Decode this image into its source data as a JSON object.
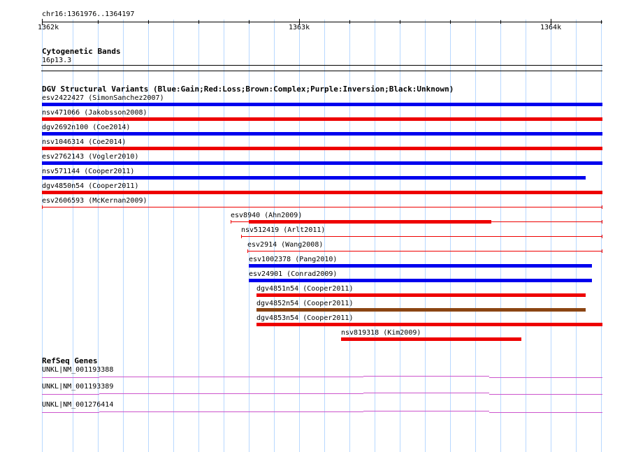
{
  "colors": {
    "gain": "#0000ee",
    "loss": "#ee0000",
    "complex": "#8b4513",
    "gene": "#cc55cc",
    "grid": "#b8d8ff"
  },
  "ruler": {
    "position_label": "chr16:1361976..1364197",
    "ticks": [
      "1362k",
      "1363k",
      "1364k"
    ]
  },
  "cytoband": {
    "title": "Cytogenetic Bands",
    "band": "16p13.3"
  },
  "dgv": {
    "title": "DGV Structural Variants (Blue:Gain;Red:Loss;Brown:Complex;Purple:Inversion;Black:Unknown)",
    "variants": [
      {
        "label": "esv2422427 (SimonSanchez2007)",
        "type": "gain",
        "start": 1361976,
        "end": 1364197
      },
      {
        "label": "nsv471066 (Jakobsson2008)",
        "type": "loss",
        "start": 1361976,
        "end": 1364197
      },
      {
        "label": "dgv2692n100 (Coe2014)",
        "type": "gain",
        "start": 1361976,
        "end": 1364197
      },
      {
        "label": "nsv1046314 (Coe2014)",
        "type": "loss",
        "start": 1361976,
        "end": 1364197
      },
      {
        "label": "esv2762143 (Vogler2010)",
        "type": "gain",
        "start": 1361976,
        "end": 1364197
      },
      {
        "label": "nsv571144 (Cooper2011)",
        "type": "gain",
        "start": 1361976,
        "end": 1364130
      },
      {
        "label": "dgv4850n54 (Cooper2011)",
        "type": "loss",
        "start": 1361976,
        "end": 1364197
      },
      {
        "label": "esv2606593 (McKernan2009)",
        "type": "loss",
        "start": 1361976,
        "end": 1364197,
        "thin": true
      },
      {
        "label": "esv8940 (Ahn2009)",
        "type": "loss",
        "start": 1362725,
        "end": 1364197,
        "thick_start": 1362795,
        "thick_end": 1363755
      },
      {
        "label": "nsv512419 (Arlt2011)",
        "type": "loss",
        "start": 1362765,
        "end": 1364197,
        "thin": true
      },
      {
        "label": "esv2914 (Wang2008)",
        "type": "loss",
        "start": 1362790,
        "end": 1364197,
        "thin": true
      },
      {
        "label": "esv1002378 (Pang2010)",
        "type": "gain",
        "start": 1362795,
        "end": 1364155
      },
      {
        "label": "esv24901 (Conrad2009)",
        "type": "gain",
        "start": 1362795,
        "end": 1364155
      },
      {
        "label": "dgv4851n54 (Cooper2011)",
        "type": "loss",
        "start": 1362825,
        "end": 1364130
      },
      {
        "label": "dgv4852n54 (Cooper2011)",
        "type": "complex",
        "start": 1362825,
        "end": 1364130
      },
      {
        "label": "dgv4853n54 (Cooper2011)",
        "type": "loss",
        "start": 1362825,
        "end": 1364197
      },
      {
        "label": "nsv819318 (Kim2009)",
        "type": "loss",
        "start": 1363160,
        "end": 1363875
      }
    ]
  },
  "refseq": {
    "title": "RefSeq Genes",
    "genes": [
      {
        "label": "UNKL|NM_001193388"
      },
      {
        "label": "UNKL|NM_001193389"
      },
      {
        "label": "UNKL|NM_001276414"
      }
    ]
  }
}
